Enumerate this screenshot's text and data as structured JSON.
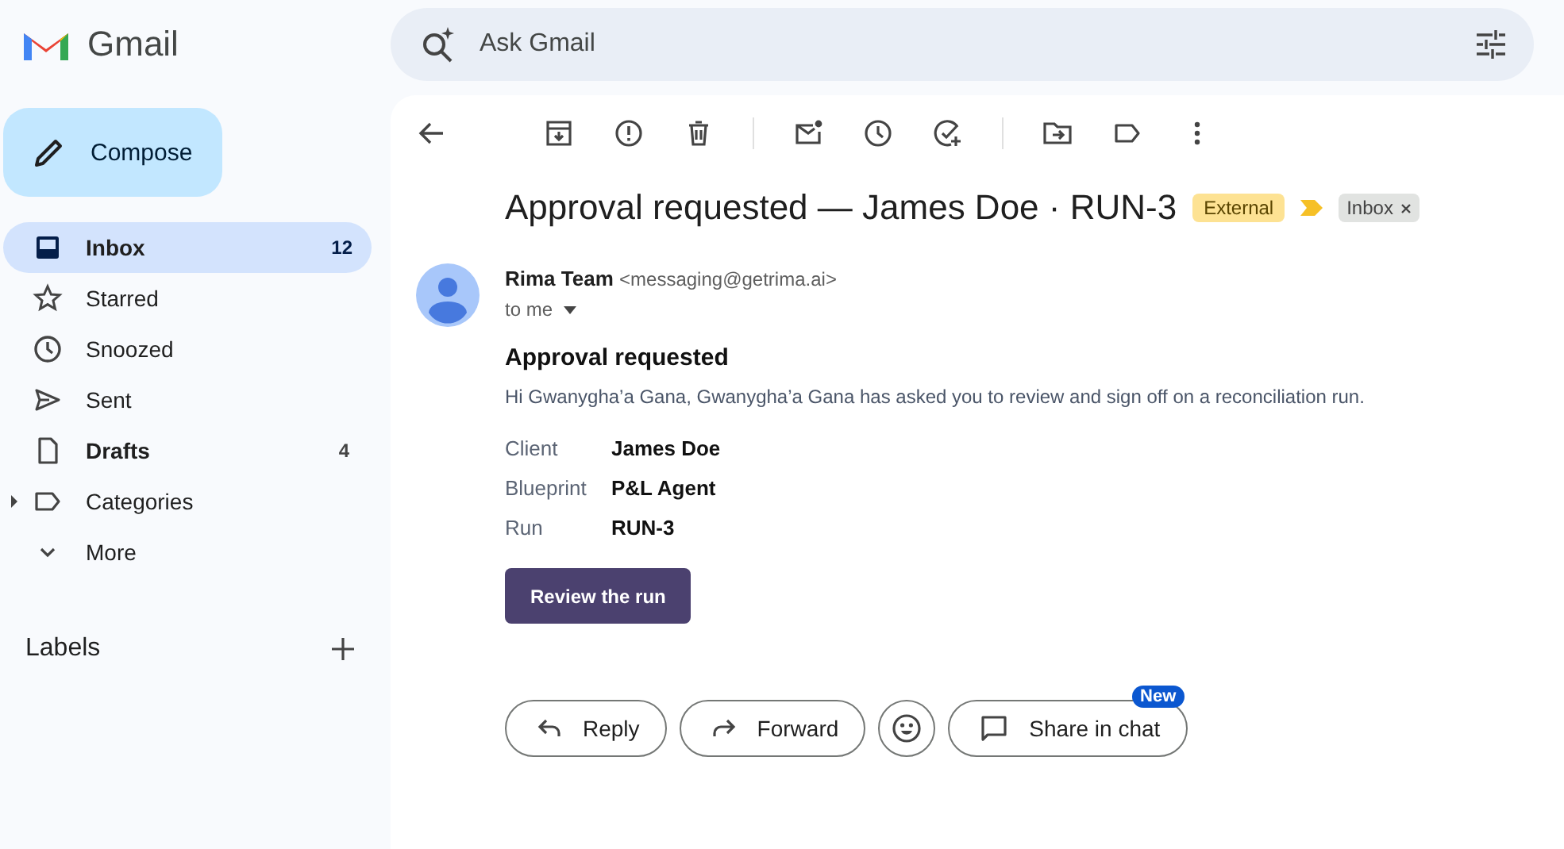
{
  "app": {
    "name": "Gmail"
  },
  "search": {
    "placeholder": "Ask Gmail"
  },
  "compose": {
    "label": "Compose"
  },
  "sidebar": {
    "items": [
      {
        "label": "Inbox",
        "count": "12",
        "selected": true,
        "unread": true
      },
      {
        "label": "Starred",
        "selected": false,
        "unread": false
      },
      {
        "label": "Snoozed",
        "selected": false,
        "unread": false
      },
      {
        "label": "Sent",
        "selected": false,
        "unread": false
      },
      {
        "label": "Drafts",
        "count": "4",
        "selected": false,
        "unread": true
      },
      {
        "label": "Categories",
        "selected": false,
        "unread": false,
        "expanded": false
      },
      {
        "label": "More",
        "selected": false,
        "unread": false
      }
    ],
    "labels_heading": "Labels"
  },
  "message": {
    "subject": "Approval requested — James Doe · RUN-3",
    "tags": [
      {
        "label": "External",
        "kind": "external",
        "color": "#fde293"
      },
      {
        "label": "Inbox",
        "kind": "folder",
        "color": "#e1e3e1",
        "removable": true
      }
    ],
    "important": true,
    "sender_name": "Rima Team",
    "sender_email": "<messaging@getrima.ai>",
    "recipient": "to me",
    "heading": "Approval requested",
    "intro": "Hi Gwanygha’a Gana, Gwanygha’a Gana has asked you to review and sign off on a reconciliation run.",
    "fields": [
      {
        "label": "Client",
        "value": "James Doe"
      },
      {
        "label": "Blueprint",
        "value": "P&L Agent"
      },
      {
        "label": "Run",
        "value": "RUN-3"
      }
    ],
    "cta": "Review the run",
    "actions": [
      {
        "label": "Reply",
        "kind": "reply"
      },
      {
        "label": "Forward",
        "kind": "forward"
      },
      {
        "kind": "emoji"
      },
      {
        "label": "Share in chat",
        "kind": "chat",
        "badge": "New"
      }
    ]
  }
}
